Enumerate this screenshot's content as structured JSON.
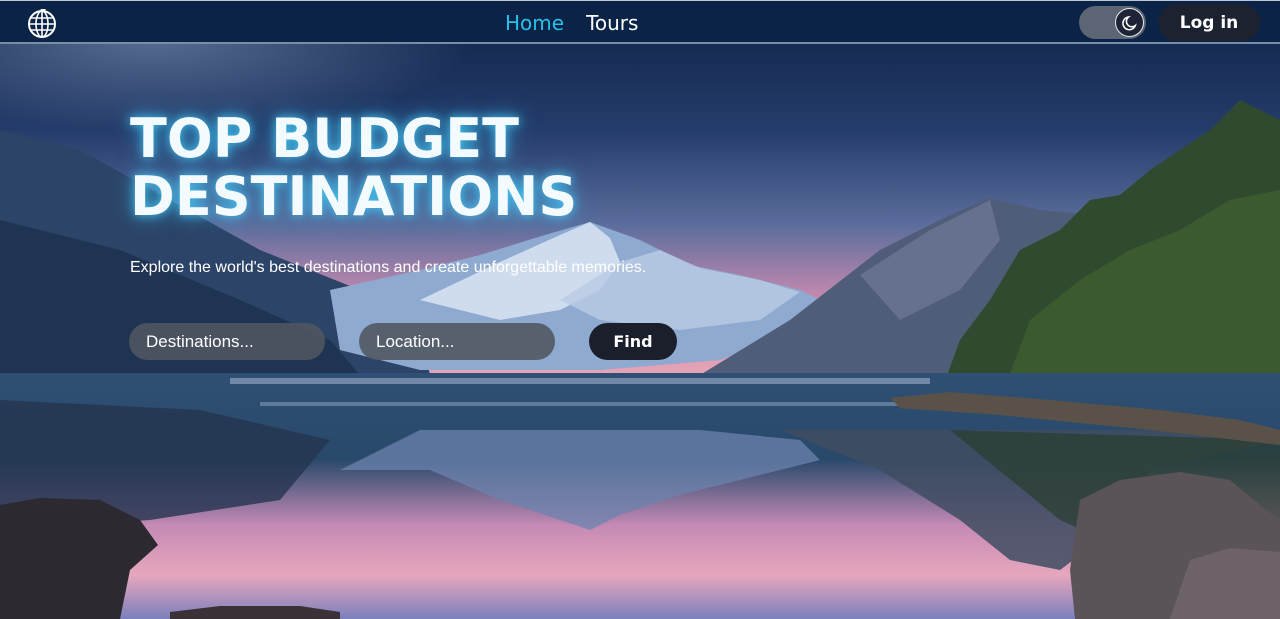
{
  "nav": {
    "logo_icon": "globe-icon",
    "links": [
      {
        "label": "Home",
        "active": true
      },
      {
        "label": "Tours",
        "active": false
      }
    ],
    "theme_toggle_icon": "moon-icon",
    "login_label": "Log in"
  },
  "hero": {
    "title_line1": "TOP BUDGET",
    "title_line2": "DESTINATIONS",
    "subtitle": "Explore the world's best destinations and create unforgettable memories.",
    "destination_placeholder": "Destinations...",
    "location_placeholder": "Location...",
    "find_label": "Find"
  },
  "colors": {
    "navbar": "#0c2348",
    "active_link": "#25c2e8",
    "button_dark": "#1d2230"
  }
}
